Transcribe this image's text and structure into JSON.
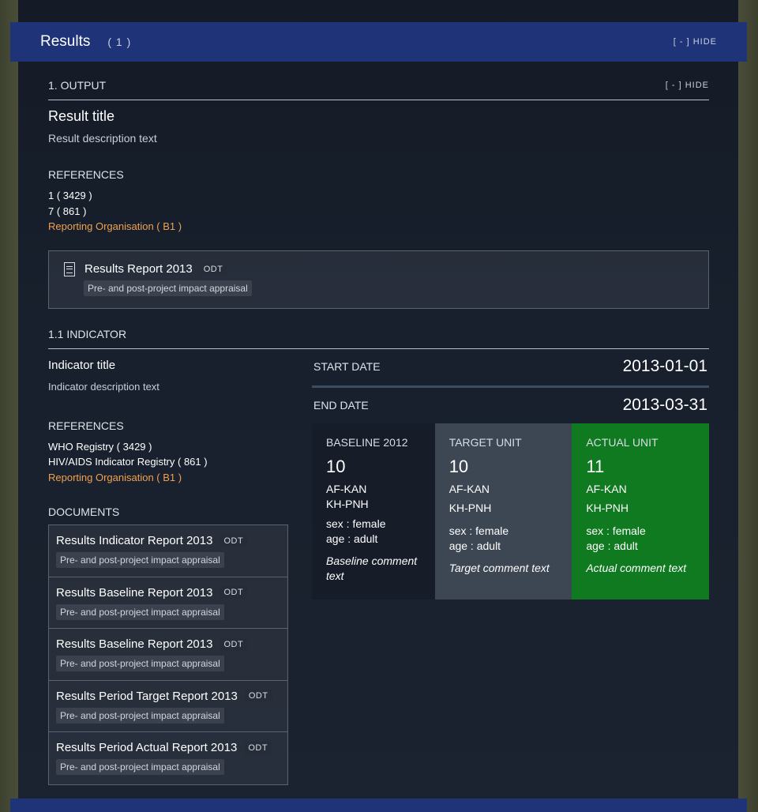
{
  "header": {
    "title": "Results",
    "count": "( 1 )",
    "hide": "[ - ] HIDE"
  },
  "output": {
    "label": "1. OUTPUT",
    "hide": "[ - ] HIDE",
    "title": "Result title",
    "description": "Result description text",
    "references_heading": "REFERENCES",
    "references": [
      "1 ( 3429 )",
      "7 ( 861 )"
    ],
    "reporting_org": "Reporting Organisation ( B1 )",
    "document": {
      "title": "Results Report 2013",
      "format": "ODT",
      "category": "Pre- and post-project impact appraisal"
    }
  },
  "indicator": {
    "label": "1.1 INDICATOR",
    "title": "Indicator title",
    "description": "Indicator description text",
    "references_heading": "REFERENCES",
    "references": [
      "WHO Registry ( 3429 )",
      "HIV/AIDS Indicator Registry ( 861 )"
    ],
    "reporting_org": "Reporting Organisation ( B1 )",
    "documents_heading": "DOCUMENTS",
    "documents": [
      {
        "title": "Results Indicator Report 2013",
        "format": "ODT",
        "category": "Pre- and post-project impact appraisal"
      },
      {
        "title": "Results Baseline Report 2013",
        "format": "ODT",
        "category": "Pre- and post-project impact appraisal"
      },
      {
        "title": "Results Baseline Report 2013",
        "format": "ODT",
        "category": "Pre- and post-project impact appraisal"
      },
      {
        "title": "Results Period Target Report 2013",
        "format": "ODT",
        "category": "Pre- and post-project impact appraisal"
      },
      {
        "title": "Results Period Actual Report 2013",
        "format": "ODT",
        "category": "Pre- and post-project impact appraisal"
      }
    ],
    "start_label": "START DATE",
    "start_date": "2013-01-01",
    "end_label": "END DATE",
    "end_date": "2013-03-31",
    "periods": {
      "baseline": {
        "label": "BASELINE 2012",
        "value": "10",
        "loc1": "AF-KAN",
        "loc2": "KH-PNH",
        "dim1": "sex : female",
        "dim2": "age : adult",
        "comment": "Baseline comment text"
      },
      "target": {
        "label": "TARGET UNIT",
        "value": "10",
        "loc1": "AF-KAN",
        "loc2": "KH-PNH",
        "dim1": "sex : female",
        "dim2": "age : adult",
        "comment": "Target comment text"
      },
      "actual": {
        "label": "ACTUAL UNIT",
        "value": "11",
        "loc1": "AF-KAN",
        "loc2": "KH-PNH",
        "dim1": "sex : female",
        "dim2": "age : adult",
        "comment": "Actual comment text"
      }
    }
  },
  "colors": {
    "header_bg": "#1f3478",
    "accent_orange": "#f0a050",
    "actual_green": "#0f7a20"
  }
}
